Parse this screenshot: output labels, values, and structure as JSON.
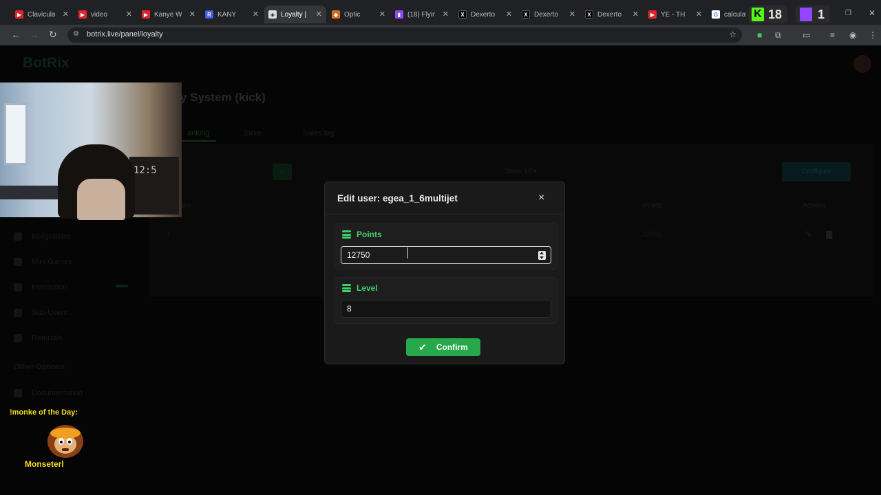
{
  "browser": {
    "tabs": [
      {
        "label": "Clavicula",
        "color": "#e0262a",
        "glyph": "▶"
      },
      {
        "label": "video",
        "color": "#e0262a",
        "glyph": "▶"
      },
      {
        "label": "Kanye W",
        "color": "#e0262a",
        "glyph": "▶"
      },
      {
        "label": "KANY",
        "color": "#4261d8",
        "glyph": "R"
      },
      {
        "label": "Loyalty |",
        "color": "#dddddd",
        "glyph": "◈"
      },
      {
        "label": "Optic",
        "color": "#d96a1e",
        "glyph": "◆"
      },
      {
        "label": "(18) Flyin",
        "color": "#9146ff",
        "glyph": "▮"
      },
      {
        "label": "Dexerto",
        "color": "#000000",
        "glyph": "X"
      },
      {
        "label": "Dexerto",
        "color": "#000000",
        "glyph": "X"
      },
      {
        "label": "Dexerto",
        "color": "#000000",
        "glyph": "X"
      },
      {
        "label": "YE - TH",
        "color": "#e0262a",
        "glyph": "▶"
      },
      {
        "label": "calculat",
        "color": "#4285f4",
        "glyph": "G"
      }
    ],
    "url": "botrix.live/panel/loyalty",
    "kick_count": "18",
    "twitch_count": "1"
  },
  "page": {
    "logo": "BotRix",
    "title": "y System (kick)",
    "tabs": [
      "anking",
      "Store",
      "Sales log"
    ],
    "show_label": "Show",
    "show_value": "10",
    "configure_label": "Configure",
    "table_headers": [
      "tion",
      "Points",
      "Actions"
    ],
    "row": {
      "rank": "1",
      "points": "12750"
    },
    "sidebar": [
      "Integrations",
      "Mini Games",
      "Interaction",
      "Sub-Users",
      "Referrals"
    ],
    "sidebar_section": "Other Options",
    "sidebar_doc": "Documentation"
  },
  "overlay": {
    "monke_title": "!monke of the Day:",
    "monke_name": "Monseterl",
    "webcam_clock": "12:5"
  },
  "modal": {
    "title": "Edit user: egea_1_6multijet",
    "close_glyph": "×",
    "points_label": "Points",
    "points_value": "12750",
    "level_label": "Level",
    "level_value": "8",
    "confirm_label": "Confirm",
    "accent": "#3dd06a",
    "button_color": "#27a84b"
  }
}
